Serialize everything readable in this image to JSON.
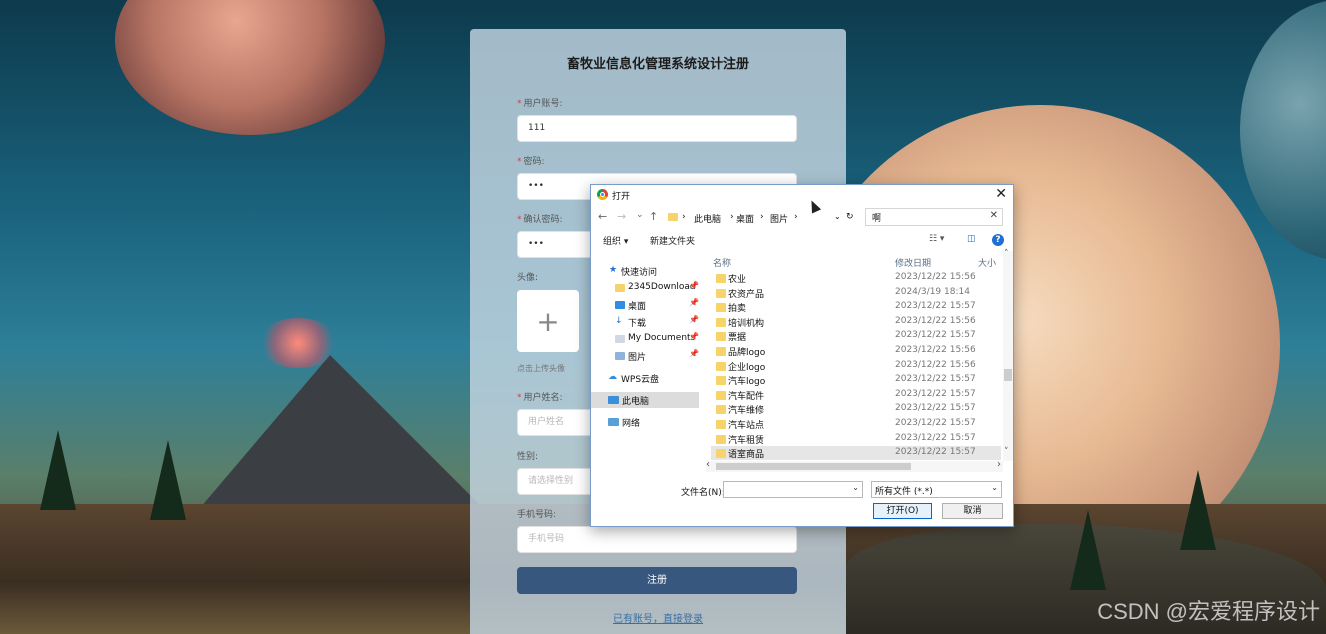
{
  "form": {
    "title": "畜牧业信息化管理系统设计注册",
    "fields": {
      "account": {
        "label": "用户账号:",
        "value": "111"
      },
      "password": {
        "label": "密码:",
        "value": "•••"
      },
      "confirm": {
        "label": "确认密码:",
        "value": "•••"
      },
      "avatar": {
        "label": "头像:",
        "hint": "点击上传头像",
        "plus": "+"
      },
      "name": {
        "label": "用户姓名:",
        "placeholder": "用户姓名"
      },
      "gender": {
        "label": "性别:",
        "placeholder": "请选择性别"
      },
      "phone": {
        "label": "手机号码:",
        "placeholder": "手机号码"
      }
    },
    "required_mark": "*",
    "submit": "注册",
    "login_link": "已有账号，直接登录"
  },
  "dialog": {
    "title": "打开",
    "close": "✕",
    "nav": {
      "back": "←",
      "forward": "→",
      "recent": "⌄",
      "up": "↑"
    },
    "breadcrumb": [
      "此电脑",
      "桌面",
      "图片"
    ],
    "sep": "›",
    "refresh": "↻",
    "dropdown": "⌄",
    "search_value": "啊",
    "search_clear": "✕",
    "organize": "组织 ▾",
    "new_folder": "新建文件夹",
    "view_icon": "☷ ▾",
    "pane_icon": "◫",
    "help": "?",
    "nav_pane": [
      {
        "label": "快速访问",
        "icon": "★"
      },
      {
        "label": "2345Download",
        "pinned": true
      },
      {
        "label": "桌面",
        "pinned": true
      },
      {
        "label": "下载",
        "pinned": true
      },
      {
        "label": "My Documents",
        "pinned": true
      },
      {
        "label": "图片",
        "pinned": true
      },
      {
        "label": "WPS云盘"
      },
      {
        "label": "此电脑"
      },
      {
        "label": "网络"
      }
    ],
    "pin_glyph": "📌",
    "columns": {
      "name": "名称",
      "date": "修改日期",
      "size": "大小"
    },
    "files": [
      {
        "name": "农业",
        "date": "2023/12/22 15:56"
      },
      {
        "name": "农资产品",
        "date": "2024/3/19 18:14"
      },
      {
        "name": "拍卖",
        "date": "2023/12/22 15:57"
      },
      {
        "name": "培训机构",
        "date": "2023/12/22 15:56"
      },
      {
        "name": "票据",
        "date": "2023/12/22 15:57"
      },
      {
        "name": "品牌logo",
        "date": "2023/12/22 15:56"
      },
      {
        "name": "企业logo",
        "date": "2023/12/22 15:56"
      },
      {
        "name": "汽车logo",
        "date": "2023/12/22 15:57"
      },
      {
        "name": "汽车配件",
        "date": "2023/12/22 15:57"
      },
      {
        "name": "汽车维修",
        "date": "2023/12/22 15:57"
      },
      {
        "name": "汽车站点",
        "date": "2023/12/22 15:57"
      },
      {
        "name": "汽车租赁",
        "date": "2023/12/22 15:57"
      },
      {
        "name": "语室商品",
        "date": "2023/12/22 15:57"
      }
    ],
    "filename_label": "文件名(N):",
    "filetype": "所有文件 (*.*)",
    "open_button": "打开(O)",
    "cancel_button": "取消",
    "scroll_left": "‹",
    "scroll_right": "›",
    "scroll_up": "˄",
    "scroll_down": "˅"
  },
  "watermark": "CSDN @宏爱程序设计"
}
